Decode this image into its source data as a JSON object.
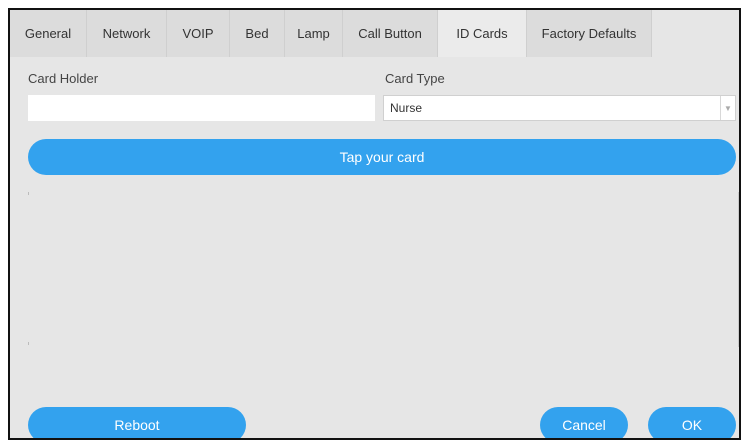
{
  "tabs": [
    {
      "label": "General",
      "active": false
    },
    {
      "label": "Network",
      "active": false
    },
    {
      "label": "VOIP",
      "active": false
    },
    {
      "label": "Bed",
      "active": false
    },
    {
      "label": "Lamp",
      "active": false
    },
    {
      "label": "Call Button",
      "active": false
    },
    {
      "label": "ID Cards",
      "active": true
    },
    {
      "label": "Factory Defaults",
      "active": false
    }
  ],
  "form": {
    "card_holder_label": "Card Holder",
    "card_holder_value": "",
    "card_type_label": "Card Type",
    "card_type_value": "Nurse"
  },
  "tap_card_label": "Tap your card",
  "footer": {
    "reboot_label": "Reboot",
    "cancel_label": "Cancel",
    "ok_label": "OK"
  },
  "colors": {
    "accent": "#33a2ee",
    "background": "#e6e6e6"
  },
  "icons": {
    "select_arrow": "chevron-down-icon"
  }
}
